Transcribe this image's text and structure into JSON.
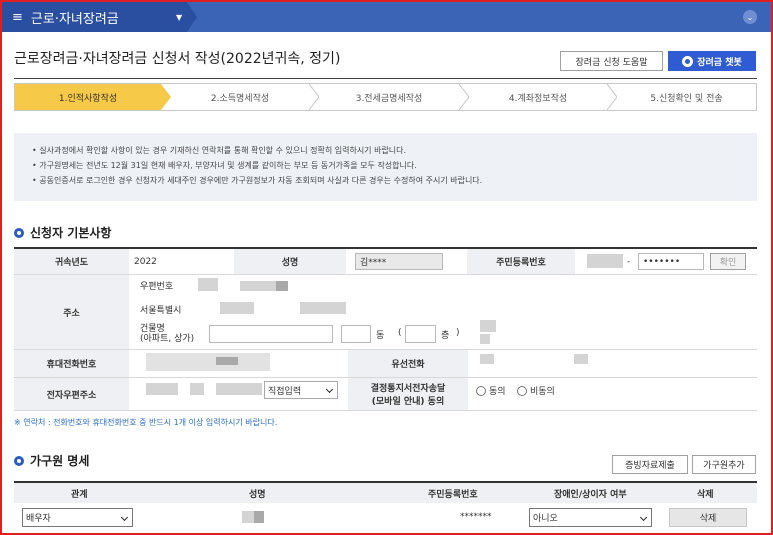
{
  "topbar": {
    "menu_icon": "hamburger-icon",
    "menu_title": "근로·자녀장려금",
    "dropdown_arrow": "▼",
    "collapse_icon": "chevron-down-circle-icon"
  },
  "header": {
    "title": "근로장려금·자녀장려금 신청서 작성(2022년귀속, 정기)",
    "help_button": "장려금 신청 도움말",
    "chatbot_button": "장려금 챗봇",
    "chatbot_color": "#2f5bd3"
  },
  "steps": [
    {
      "label": "1.인적사항작성",
      "active": true
    },
    {
      "label": "2.소득명세작성",
      "active": false
    },
    {
      "label": "3.전세금명세작성",
      "active": false
    },
    {
      "label": "4.계좌정보작성",
      "active": false
    },
    {
      "label": "5.신청확인 및 전송",
      "active": false
    }
  ],
  "notices": [
    "실사과정에서 확인할 사항이 있는 경우 기재하신 연락처를 통해 확인할 수 있으니 정확히 입력하시기 바랍니다.",
    "가구원명세는 전년도 12월 31일 현재 배우자, 부양자녀 및 생계를 같이하는 부모 등 동거가족을 모두 작성합니다.",
    "공동인증서로 로그인한 경우 신청자가 세대주인 경우에만 가구원정보가 자동 조회되며 사실과 다른 경우는 수정하여 주시기 바랍니다."
  ],
  "applicant_section": {
    "title": "신청자 기본사항",
    "year_label": "귀속년도",
    "year_value": "2022",
    "name_label": "성명",
    "name_value": "김****",
    "rrn_label": "주민등록번호",
    "rrn_dash": "-",
    "rrn_back": "•••••••",
    "confirm_button": "확인",
    "address_label": "주소",
    "postal_label": "우편번호",
    "city_value": "서울특별시",
    "building_label_1": "건물명",
    "building_label_2": "(아파트, 상가)",
    "dong_label": "동",
    "paren_open": "(",
    "floor_label": "층",
    "paren_close": ")",
    "mobile_label": "휴대전화번호",
    "landline_label": "유선전화",
    "email_label": "전자우편주소",
    "email_domain_select": "직접입력",
    "consent_label_1": "결정통지서전자송달",
    "consent_label_2": "(모바일 안내) 동의",
    "consent_yes": "동의",
    "consent_no": "비동의"
  },
  "contact_note": "※ 연락처 : 전화번호와 휴대전화번호 중 반드시 1개 이상 입력하시기 바랍니다.",
  "household_section": {
    "title": "가구원 명세",
    "evidence_button": "증빙자료제출",
    "add_button": "가구원추가",
    "columns": [
      "관계",
      "성명",
      "주민등록번호",
      "장애인/상이자 여부",
      "삭제"
    ],
    "rows": [
      {
        "relation": "배우자",
        "rrn": "*******",
        "disabled": "아니오",
        "delete": "삭제"
      }
    ]
  }
}
